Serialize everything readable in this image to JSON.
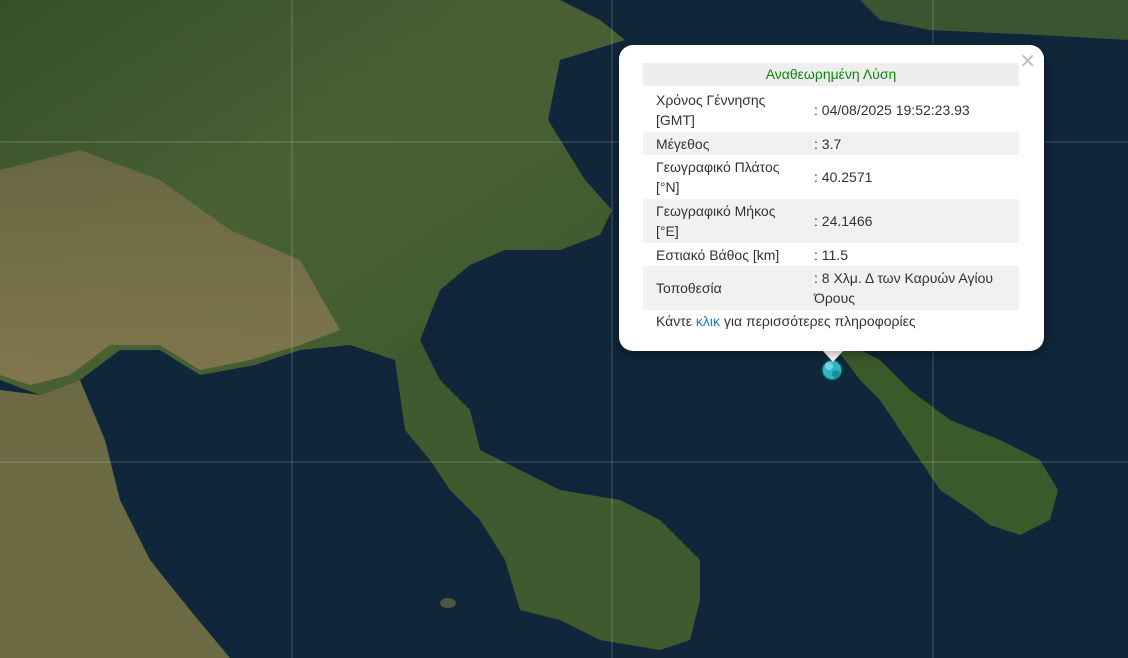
{
  "popup": {
    "title": "Αναθεωρημένη Λύση",
    "close_symbol": "×",
    "rows": [
      {
        "label": "Χρόνος Γέννησης [GMT]",
        "value": ": 04/08/2025 19:52:23.93"
      },
      {
        "label": "Μέγεθος",
        "value": ": 3.7"
      },
      {
        "label": "Γεωγραφικό Πλάτος [°N]",
        "value": ": 40.2571"
      },
      {
        "label": "Γεωγραφικό Μήκος [°E]",
        "value": ": 24.1466"
      },
      {
        "label": "Εστιακό Βάθος [km]",
        "value": ": 11.5"
      },
      {
        "label": "Τοποθεσία",
        "value": ": 8 Χλμ. Δ των Καρυών Αγίου Όρους"
      }
    ],
    "more_prefix": "Κάντε ",
    "more_link": "κλικ",
    "more_suffix": " για περισσότερες πληροφορίες"
  },
  "map": {
    "sea_color": "#0f2538",
    "land_color": "#3d5a2a",
    "marker_color": "#2fb7c8",
    "marker_icon": "earthquake-marker-icon"
  }
}
